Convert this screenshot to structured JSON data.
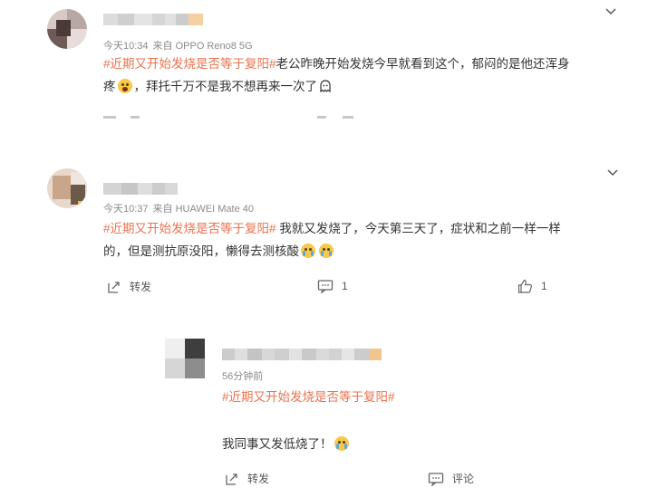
{
  "comments": [
    {
      "time": "今天10:34",
      "from": "来自 OPPO Reno8 5G",
      "hashtag": "#近期又开始发烧是否等于复阳#",
      "text_line1": "老公昨晚开始发烧今早就看到这个，郁闷的是他还浑身",
      "text_line2_prefix": "疼",
      "emoji1": "emoji-shocked",
      "text_line2_rest": "，拜托千万不是我不想再来一次了",
      "end_icon": "ghost-icon"
    },
    {
      "time": "今天10:37",
      "from": "来自 HUAWEI Mate 40",
      "hashtag": "#近期又开始发烧是否等于复阳#",
      "text_line1": " 我就又发烧了，今天第三天了，症状和之前一样一样",
      "text_line2": "的，但是测抗原没阳，懒得去测核酸",
      "emoji": "emoji-crying",
      "repost_label": "转发",
      "comment_count": "1",
      "like_count": "1"
    }
  ],
  "reply": {
    "time": "56分钟前",
    "hashtag": "#近期又开始发烧是否等于复阳#",
    "text": "我同事又发低烧了！",
    "emoji": "emoji-crying",
    "repost_label": "转发",
    "comment_label": "评论"
  },
  "colors": {
    "hashtag": "#eb7350",
    "meta": "#8a8a8a",
    "text": "#333333"
  }
}
